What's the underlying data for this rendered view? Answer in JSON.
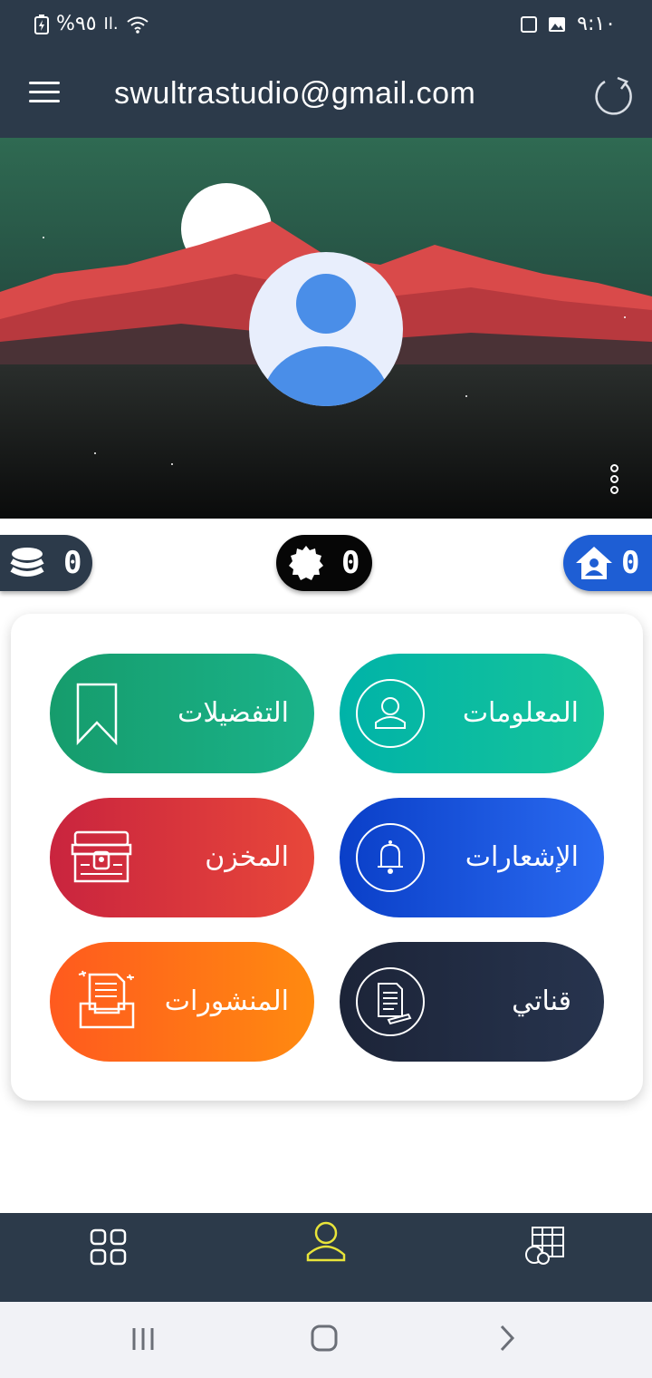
{
  "status_bar": {
    "battery": "%٩٥",
    "signal": "Il.",
    "time": "٩:١٠"
  },
  "app_bar": {
    "title": "swultrastudio@gmail.com",
    "menu_icon": "hamburger-menu-icon",
    "refresh_icon": "refresh-icon"
  },
  "banner": {
    "sky_colors": [
      "#2f6a52",
      "#1a3a34"
    ],
    "mountain_color": "#d94a4a",
    "avatar_color": "#4a8ee8"
  },
  "counters": {
    "coins": "0",
    "badges": "0",
    "home": "0"
  },
  "tiles": [
    {
      "label": "المعلومات",
      "icon": "user-icon",
      "gradient": [
        "#00b3a8",
        "#17c49a"
      ]
    },
    {
      "label": "التفضيلات",
      "icon": "bookmark-icon",
      "gradient": [
        "#169c6c",
        "#1ab38a"
      ]
    },
    {
      "label": "الإشعارات",
      "icon": "bell-icon",
      "gradient": [
        "#0a3fc8",
        "#2a6af0"
      ]
    },
    {
      "label": "المخزن",
      "icon": "treasure-chest-icon",
      "gradient": [
        "#c9243e",
        "#e8473a"
      ]
    },
    {
      "label": "قناتي",
      "icon": "document-pen-icon",
      "gradient": [
        "#1c2438",
        "#27344e"
      ]
    },
    {
      "label": "المنشورات",
      "icon": "posts-inbox-icon",
      "gradient": [
        "#ff5a1e",
        "#ff8a10"
      ]
    }
  ],
  "bottom_nav": {
    "items": [
      "grid-icon",
      "profile-icon",
      "calendar-fruits-icon"
    ],
    "active_color": "#e8e43a"
  },
  "system_nav": [
    "recent-apps-icon",
    "home-icon",
    "back-icon"
  ]
}
